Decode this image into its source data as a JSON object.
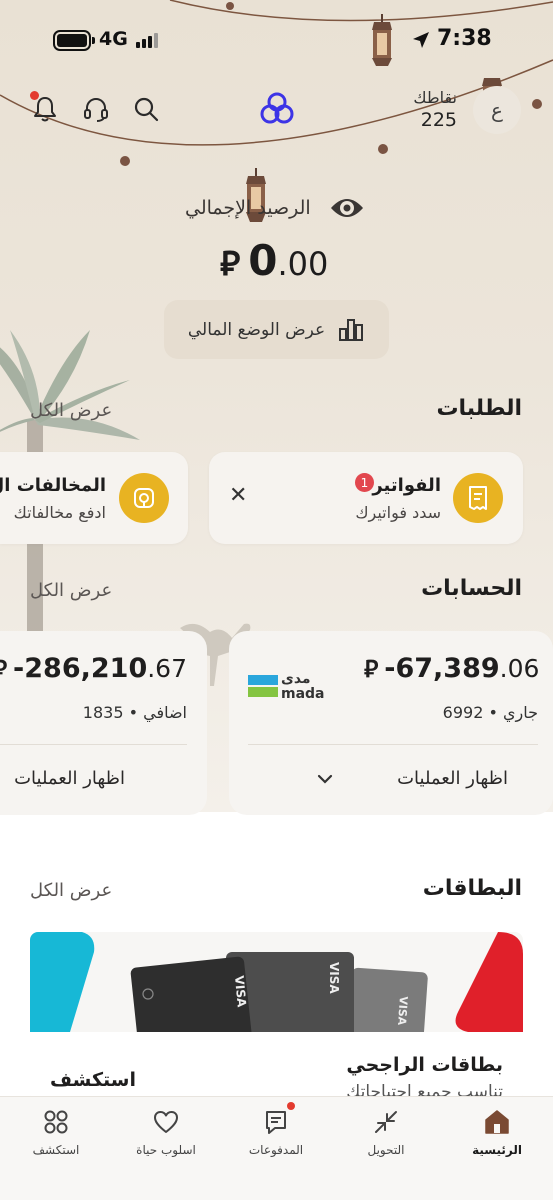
{
  "status_bar": {
    "network": "4G",
    "time": "7:38"
  },
  "header": {
    "points_label": "نقاطك",
    "points_value": "225",
    "avatar_initial": "ع"
  },
  "balance": {
    "label": "الرصيد الإجمالي",
    "currency": "⃁",
    "integer": "0",
    "decimal": ".00",
    "financial_button": "عرض الوضع المالي"
  },
  "requests": {
    "title": "الطلبات",
    "see_all": "عرض الكل",
    "items": [
      {
        "title": "الفواتير",
        "subtitle": "سدد فواتيرك",
        "badge": "1",
        "icon": "bill-icon"
      },
      {
        "title": "المخالفات ال",
        "subtitle": "ادفع مخالفاتك",
        "icon": "steering-wheel-icon"
      }
    ]
  },
  "accounts": {
    "title": "الحسابات",
    "see_all": "عرض الكل",
    "items": [
      {
        "currency": "⃁",
        "integer": "-67,389",
        "decimal": ".06",
        "type": "جاري • 6992",
        "action": "اظهار العمليات",
        "logo_text_ar": "مدى",
        "logo_text_en": "mada"
      },
      {
        "currency": "⃁",
        "integer": "-286,210",
        "decimal": ".67",
        "type": "اضافي • 1835",
        "action": "اظهار العمليات"
      }
    ]
  },
  "cards": {
    "title": "البطاقات",
    "see_all": "عرض الكل",
    "featured_title": "بطاقات الراجحي",
    "featured_subtitle": "تناسب جميع احتياجاتك",
    "explore_label": "استكشف"
  },
  "bottom_nav": [
    {
      "label": "الرئيسية",
      "icon": "home-icon",
      "active": true
    },
    {
      "label": "التحويل",
      "icon": "transfer-icon",
      "active": false
    },
    {
      "label": "المدفوعات",
      "icon": "payments-icon",
      "active": false
    },
    {
      "label": "اسلوب حياة",
      "icon": "heart-icon",
      "active": false
    },
    {
      "label": "استكشف",
      "icon": "explore-icon",
      "active": false
    }
  ],
  "colors": {
    "accent": "#e8b322",
    "brand": "#3d34e6",
    "notification": "#e33b2f",
    "background": "#ece5da"
  }
}
